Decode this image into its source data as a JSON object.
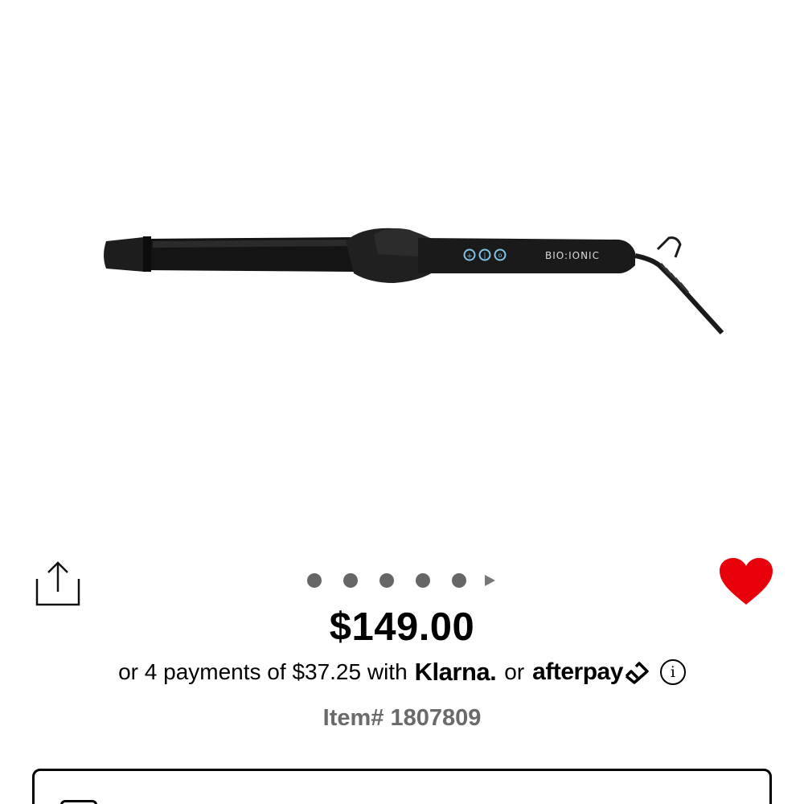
{
  "product": {
    "image_alt": "Bio Ionic curling iron",
    "brand_mark": "BIO|IONIC",
    "price": "$149.00",
    "installments": {
      "prefix": "or 4 payments of $37.25 with",
      "klarna": "Klarna.",
      "middle": "or",
      "afterpay": "afterpay"
    },
    "item_number": "Item# 1807809"
  },
  "carousel": {
    "dot_count": 5,
    "has_next_arrow": true
  },
  "icons": {
    "share": "share-icon",
    "favorite": "heart-icon",
    "info": "info-icon",
    "afterpay_loop": "afterpay-loop-icon"
  },
  "colors": {
    "heart": "#e8000b",
    "dot": "#666666",
    "item_number": "#6a6a6a",
    "button_glow": "#7fc4e8"
  }
}
